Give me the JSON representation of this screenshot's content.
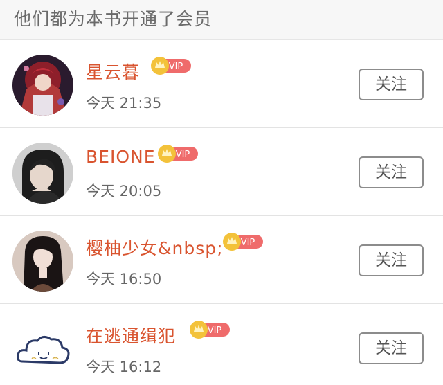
{
  "header": {
    "title": "他们都为本书开通了会员"
  },
  "members": [
    {
      "name": "星云暮",
      "time": "今天 21:35",
      "badge": "VIP",
      "follow_label": "关注",
      "avatar": "anime-girl-avatar"
    },
    {
      "name": "BEIONE",
      "time": "今天 20:05",
      "badge": "VIP",
      "follow_label": "关注",
      "avatar": "girl-photo-avatar"
    },
    {
      "name": "樱柚少女&nbsp;",
      "time": "今天 16:50",
      "badge": "VIP",
      "follow_label": "关注",
      "avatar": "girl-longhair-avatar"
    },
    {
      "name": "在逃通缉犯",
      "time": "今天 16:12",
      "badge": "VIP",
      "follow_label": "关注",
      "avatar": "cloud-face-avatar"
    }
  ],
  "colors": {
    "name": "#d9542f",
    "vip_pink": "#ef6b6b",
    "vip_gold": "#f3c23a"
  }
}
